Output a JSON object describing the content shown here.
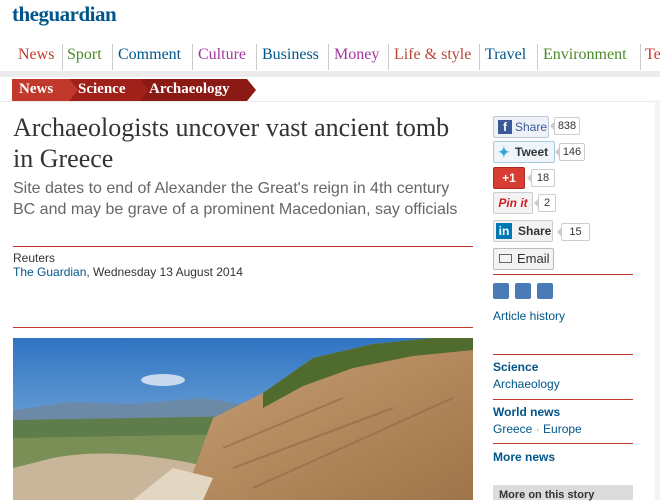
{
  "site": {
    "logo": "theguardian"
  },
  "nav": {
    "items": [
      {
        "label": "News",
        "color": "#c0392b"
      },
      {
        "label": "Sport",
        "color": "#4a8a2a"
      },
      {
        "label": "Comment",
        "color": "#005689"
      },
      {
        "label": "Culture",
        "color": "#a1389b"
      },
      {
        "label": "Business",
        "color": "#005689"
      },
      {
        "label": "Money",
        "color": "#a1389b"
      },
      {
        "label": "Life & style",
        "color": "#b5473a"
      },
      {
        "label": "Travel",
        "color": "#005689"
      },
      {
        "label": "Environment",
        "color": "#4a8a2a"
      },
      {
        "label": "Te",
        "color": "#c0392b"
      }
    ]
  },
  "breadcrumb": [
    {
      "label": "News",
      "color": "#c0392b"
    },
    {
      "label": "Science",
      "color": "#a0201a"
    },
    {
      "label": "Archaeology",
      "color": "#8c1a14"
    }
  ],
  "article": {
    "headline": "Archaeologists uncover vast ancient tomb in Greece",
    "standfirst": "Site dates to end of Alexander the Great's reign in 4th century BC and may be grave of a prominent Macedonian, say officials",
    "byline": "Reuters",
    "source": "The Guardian",
    "date": ", Wednesday 13 August 2014"
  },
  "share": {
    "facebook": {
      "label": "Share",
      "count": "838",
      "icon": "facebook-icon"
    },
    "twitter": {
      "label": "Tweet",
      "count": "146",
      "icon": "twitter-icon"
    },
    "gplus": {
      "label": "+1",
      "count": "18",
      "icon": "google-plus-icon"
    },
    "pinterest": {
      "label": "Pin it",
      "count": "2",
      "icon": "pinterest-icon"
    },
    "linkedin": {
      "label": "Share",
      "count": "15",
      "icon": "linkedin-icon"
    },
    "email": {
      "label": "Email",
      "icon": "email-icon"
    }
  },
  "sidebar": {
    "article_history": "Article history",
    "science": "Science",
    "archaeology": "Archaeology",
    "world_news": "World news",
    "greece": "Greece",
    "dot": " · ",
    "europe": "Europe",
    "more_news": "More news",
    "more_on_story": "More on this story"
  }
}
